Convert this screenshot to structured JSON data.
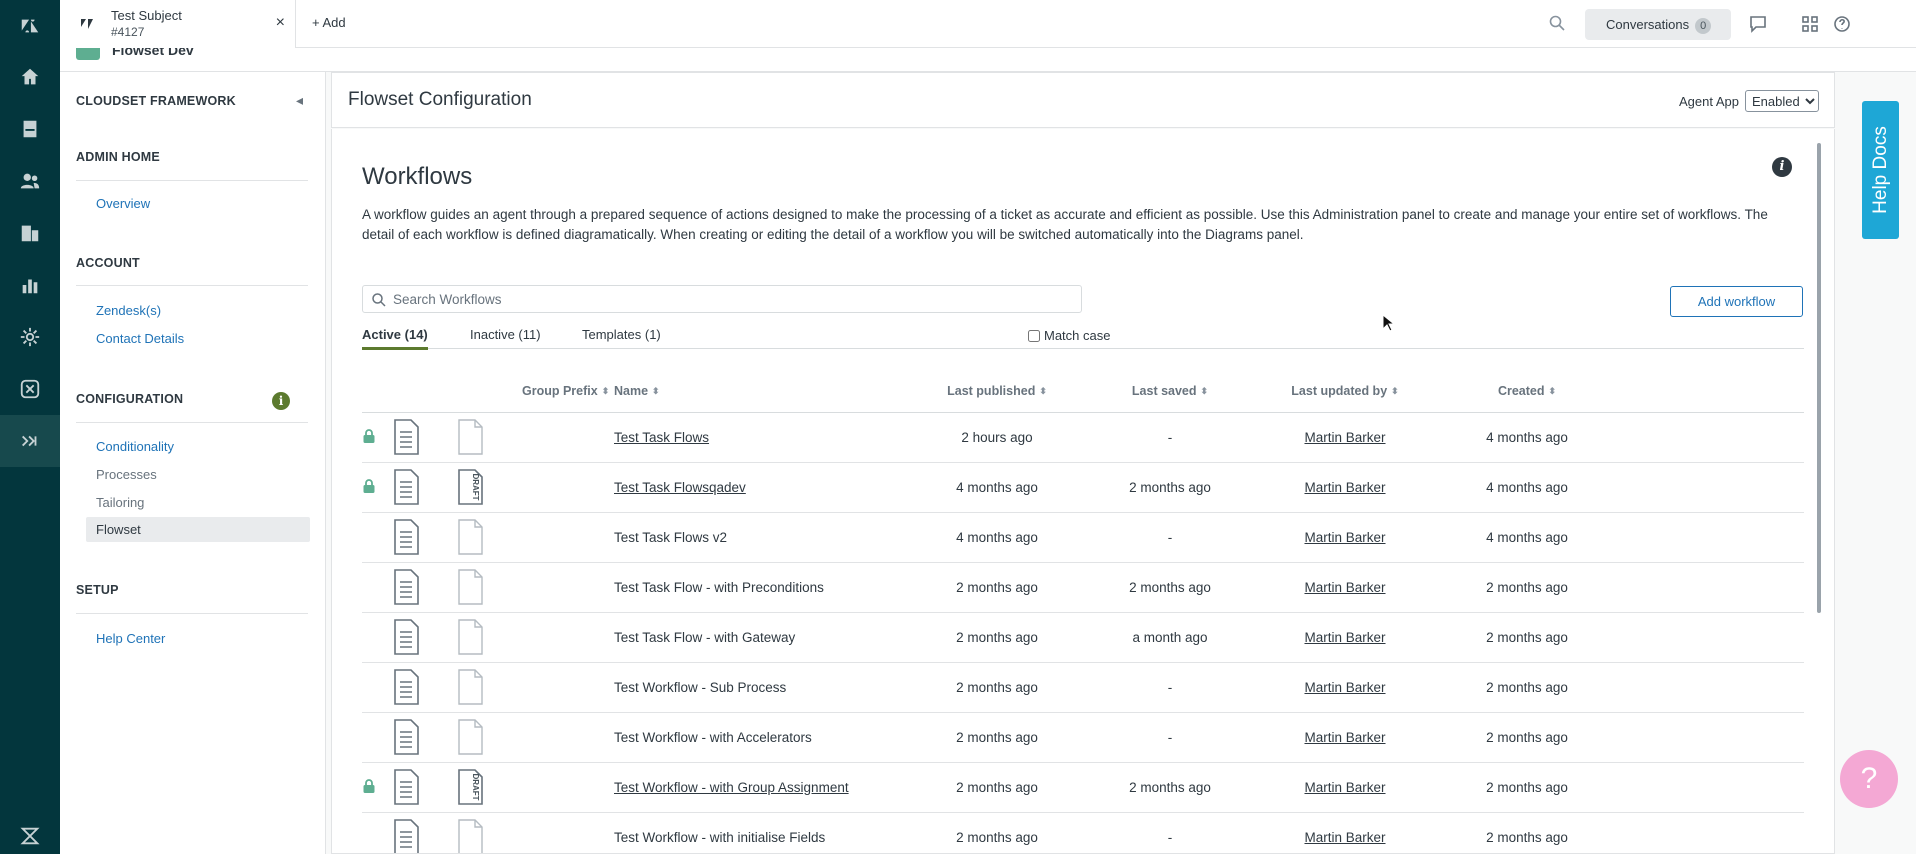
{
  "topbar": {
    "tab_title": "Test Subject",
    "tab_subtitle": "#4127",
    "tab_close": "×",
    "add_label": "+ Add",
    "conversations_label": "Conversations",
    "conversations_count": "0"
  },
  "app": {
    "title": "Flowset Dev"
  },
  "sidebar": {
    "framework": "CLOUDSET FRAMEWORK",
    "admin_home": "ADMIN HOME",
    "overview": "Overview",
    "account": "ACCOUNT",
    "zendesks": "Zendesk(s)",
    "contact_details": "Contact Details",
    "configuration": "CONFIGURATION",
    "conditionality": "Conditionality",
    "processes": "Processes",
    "tailoring": "Tailoring",
    "flowset": "Flowset",
    "setup": "SETUP",
    "help_center": "Help Center",
    "config_info": "i"
  },
  "header": {
    "title": "Flowset Configuration",
    "agent_app_label": "Agent App",
    "agent_app_value": "Enabled"
  },
  "workflows": {
    "heading": "Workflows",
    "description": "A workflow guides an agent through a prepared sequence of actions designed to make the processing of a ticket as accurate and efficient as possible. Use this Administration panel to create and manage your entire set of workflows. The detail of each workflow is defined diagramatically. When creating or editing the detail of a workflow you will be switched automatically into the Diagrams panel.",
    "info": "i",
    "search_placeholder": "Search Workflows",
    "add_button": "Add workflow",
    "tabs": {
      "active": "Active (14)",
      "inactive": "Inactive (11)",
      "templates": "Templates (1)"
    },
    "match_case": "Match case",
    "columns": {
      "group_prefix": "Group Prefix",
      "name": "Name",
      "last_published": "Last published",
      "last_saved": "Last saved",
      "last_updated_by": "Last updated by",
      "created": "Created"
    },
    "rows": [
      {
        "locked": true,
        "draft": false,
        "name": "Test Task Flows",
        "name_link": true,
        "last_published": "2 hours ago",
        "last_saved": "-",
        "updated_by": "Martin Barker",
        "created": "4 months ago"
      },
      {
        "locked": true,
        "draft": true,
        "name": "Test Task Flowsqadev",
        "name_link": true,
        "last_published": "4 months ago",
        "last_saved": "2 months ago",
        "updated_by": "Martin Barker",
        "created": "4 months ago"
      },
      {
        "locked": false,
        "draft": false,
        "name": "Test Task Flows v2",
        "name_link": false,
        "last_published": "4 months ago",
        "last_saved": "-",
        "updated_by": "Martin Barker",
        "created": "4 months ago"
      },
      {
        "locked": false,
        "draft": false,
        "name": "Test Task Flow - with Preconditions",
        "name_link": false,
        "last_published": "2 months ago",
        "last_saved": "2 months ago",
        "updated_by": "Martin Barker",
        "created": "2 months ago"
      },
      {
        "locked": false,
        "draft": false,
        "name": "Test Task Flow - with Gateway",
        "name_link": false,
        "last_published": "2 months ago",
        "last_saved": "a month ago",
        "updated_by": "Martin Barker",
        "created": "2 months ago"
      },
      {
        "locked": false,
        "draft": false,
        "name": "Test Workflow - Sub Process",
        "name_link": false,
        "last_published": "2 months ago",
        "last_saved": "-",
        "updated_by": "Martin Barker",
        "created": "2 months ago"
      },
      {
        "locked": false,
        "draft": false,
        "name": "Test Workflow - with Accelerators",
        "name_link": false,
        "last_published": "2 months ago",
        "last_saved": "-",
        "updated_by": "Martin Barker",
        "created": "2 months ago"
      },
      {
        "locked": true,
        "draft": true,
        "name": "Test Workflow - with Group Assignment",
        "name_link": true,
        "last_published": "2 months ago",
        "last_saved": "2 months ago",
        "updated_by": "Martin Barker",
        "created": "2 months ago"
      },
      {
        "locked": false,
        "draft": false,
        "name": "Test Workflow - with initialise Fields",
        "name_link": false,
        "last_published": "2 months ago",
        "last_saved": "-",
        "updated_by": "Martin Barker",
        "created": "2 months ago"
      }
    ]
  },
  "help_docs": "Help Docs",
  "help_button": "?",
  "draft_label": "DRAFT",
  "colors": {
    "rail": "#03363d",
    "accent": "#1f73b7",
    "active_tab": "#5c7a2e",
    "lock": "#5eae91",
    "help_docs": "#1ea7d6",
    "help_button": "#f4a8d4"
  }
}
